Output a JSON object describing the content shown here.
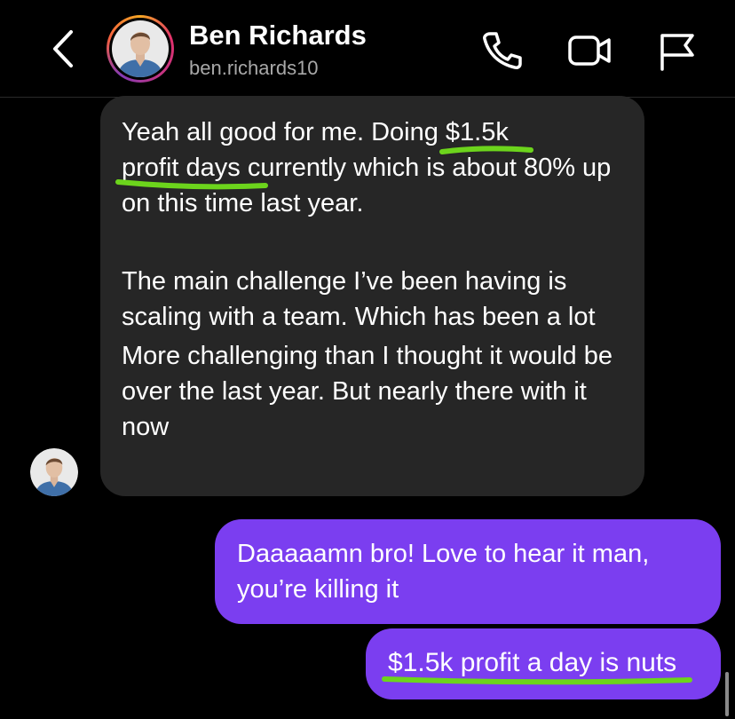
{
  "header": {
    "name": "Ben Richards",
    "handle": "ben.richards10"
  },
  "messages": {
    "received": {
      "p1_a": "Yeah all good for me. Doing ",
      "p1_highlight1": "$1.5k",
      "p1_highlight2": "profit days",
      "p1_b": " currently which is about 80% up on this time last year.",
      "p2": "The main challenge I’ve been having is scaling with a team. Which has been a lot",
      "p3": "More challenging than I thought it would be over the last year. But nearly there with it now"
    },
    "sent1": "Daaaaamn bro! Love to hear it man, you’re killing it",
    "sent2": "$1.5k profit a day is nuts"
  },
  "colors": {
    "background": "#000000",
    "received_bubble": "#262626",
    "sent_bubble": "#7b3ef0",
    "highlight": "#6cd41c",
    "secondary_text": "#a8a8a8"
  },
  "icons": {
    "back": "chevron-left-icon",
    "call": "phone-icon",
    "video": "video-camera-icon",
    "report": "flag-icon"
  }
}
